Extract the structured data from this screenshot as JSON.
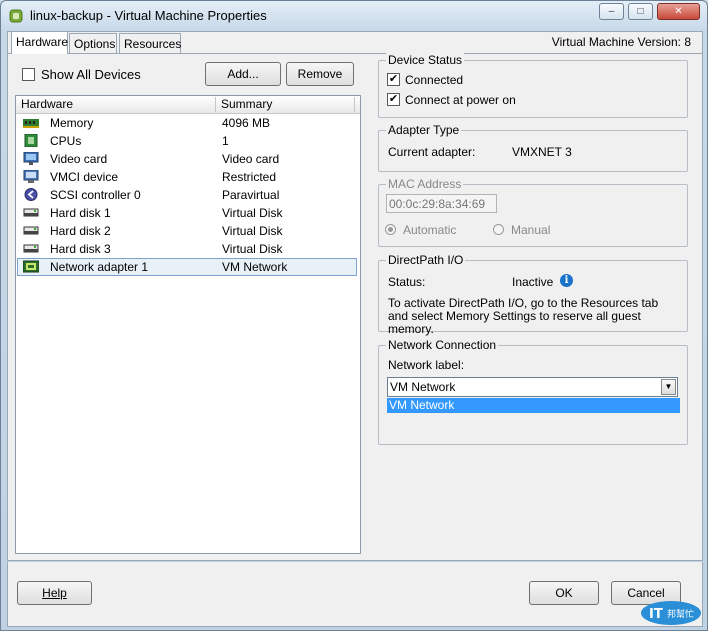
{
  "window": {
    "title": "linux-backup - Virtual Machine Properties",
    "controls": {
      "minimize": "–",
      "maximize": "□",
      "close": "✕"
    }
  },
  "tabs": [
    {
      "label": "Hardware",
      "active": true
    },
    {
      "label": "Options",
      "active": false
    },
    {
      "label": "Resources",
      "active": false
    }
  ],
  "vm_version": "Virtual Machine Version: 8",
  "toolbar": {
    "show_all_devices": "Show All Devices",
    "add_label": "Add...",
    "remove_label": "Remove"
  },
  "hardware_list": {
    "columns": [
      "Hardware",
      "Summary"
    ],
    "rows": [
      {
        "name": "Memory",
        "summary": "4096 MB",
        "icon": "memory-icon"
      },
      {
        "name": "CPUs",
        "summary": "1",
        "icon": "cpu-icon"
      },
      {
        "name": "Video card",
        "summary": "Video card",
        "icon": "monitor-icon"
      },
      {
        "name": "VMCI device",
        "summary": "Restricted",
        "icon": "vmci-icon"
      },
      {
        "name": "SCSI controller 0",
        "summary": "Paravirtual",
        "icon": "scsi-icon"
      },
      {
        "name": "Hard disk 1",
        "summary": "Virtual Disk",
        "icon": "disk-icon"
      },
      {
        "name": "Hard disk 2",
        "summary": "Virtual Disk",
        "icon": "disk-icon"
      },
      {
        "name": "Hard disk 3",
        "summary": "Virtual Disk",
        "icon": "disk-icon"
      },
      {
        "name": "Network adapter 1",
        "summary": "VM Network",
        "icon": "network-adapter-icon",
        "selected": true
      }
    ]
  },
  "device_status": {
    "legend": "Device Status",
    "connected": "Connected",
    "connect_at_power_on": "Connect at power on"
  },
  "adapter_type": {
    "legend": "Adapter Type",
    "label": "Current adapter:",
    "value": "VMXNET 3"
  },
  "mac_address": {
    "legend": "MAC Address",
    "value": "00:0c:29:8a:34:69",
    "automatic": "Automatic",
    "manual": "Manual"
  },
  "directpath": {
    "legend": "DirectPath I/O",
    "status_label": "Status:",
    "status_value": "Inactive",
    "note": "To activate DirectPath I/O, go to the Resources tab and select Memory Settings to reserve all guest memory."
  },
  "network_connection": {
    "legend": "Network Connection",
    "label": "Network label:",
    "selected": "VM Network",
    "options": [
      "VM Network"
    ]
  },
  "footer": {
    "help": "Help",
    "ok": "OK",
    "cancel": "Cancel"
  },
  "watermark": "IT邦幫忙",
  "colors": {
    "selection": "#3399ff",
    "row_selected": "#e8f0f8",
    "info": "#1a73c9"
  }
}
